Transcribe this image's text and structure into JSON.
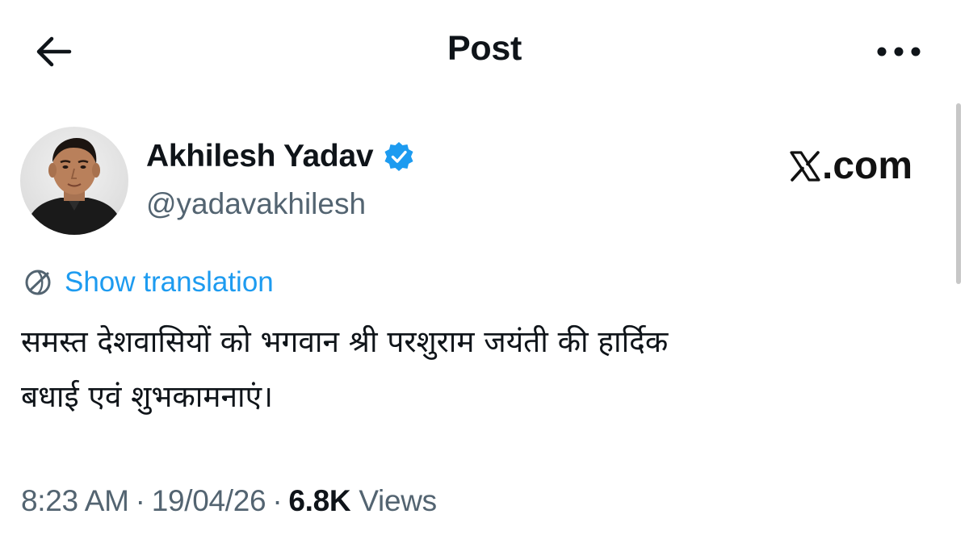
{
  "header": {
    "title": "Post",
    "back_icon": "arrow-left-icon",
    "more_icon": "more-horizontal-icon"
  },
  "author": {
    "display_name": "Akhilesh Yadav",
    "handle": "@yadavakhilesh",
    "verified_icon": "verified-badge-icon",
    "verified_color": "#1d9bf0"
  },
  "watermark": {
    "text": ".com",
    "logo_icon": "x-logo-icon"
  },
  "translation": {
    "label": "Show translation",
    "icon": "globe-icon",
    "color": "#1d9bf0"
  },
  "post": {
    "text": "समस्त देशवासियों को भगवान श्री परशुराम जयंती की हार्दिक\nबधाई एवं शुभकामनाएं।"
  },
  "meta": {
    "time": "8:23 AM",
    "date": "19/04/26",
    "separator": "·",
    "views_count": "6.8K",
    "views_label": "Views"
  },
  "colors": {
    "text_primary": "#0f1419",
    "text_secondary": "#536471",
    "accent": "#1d9bf0"
  }
}
